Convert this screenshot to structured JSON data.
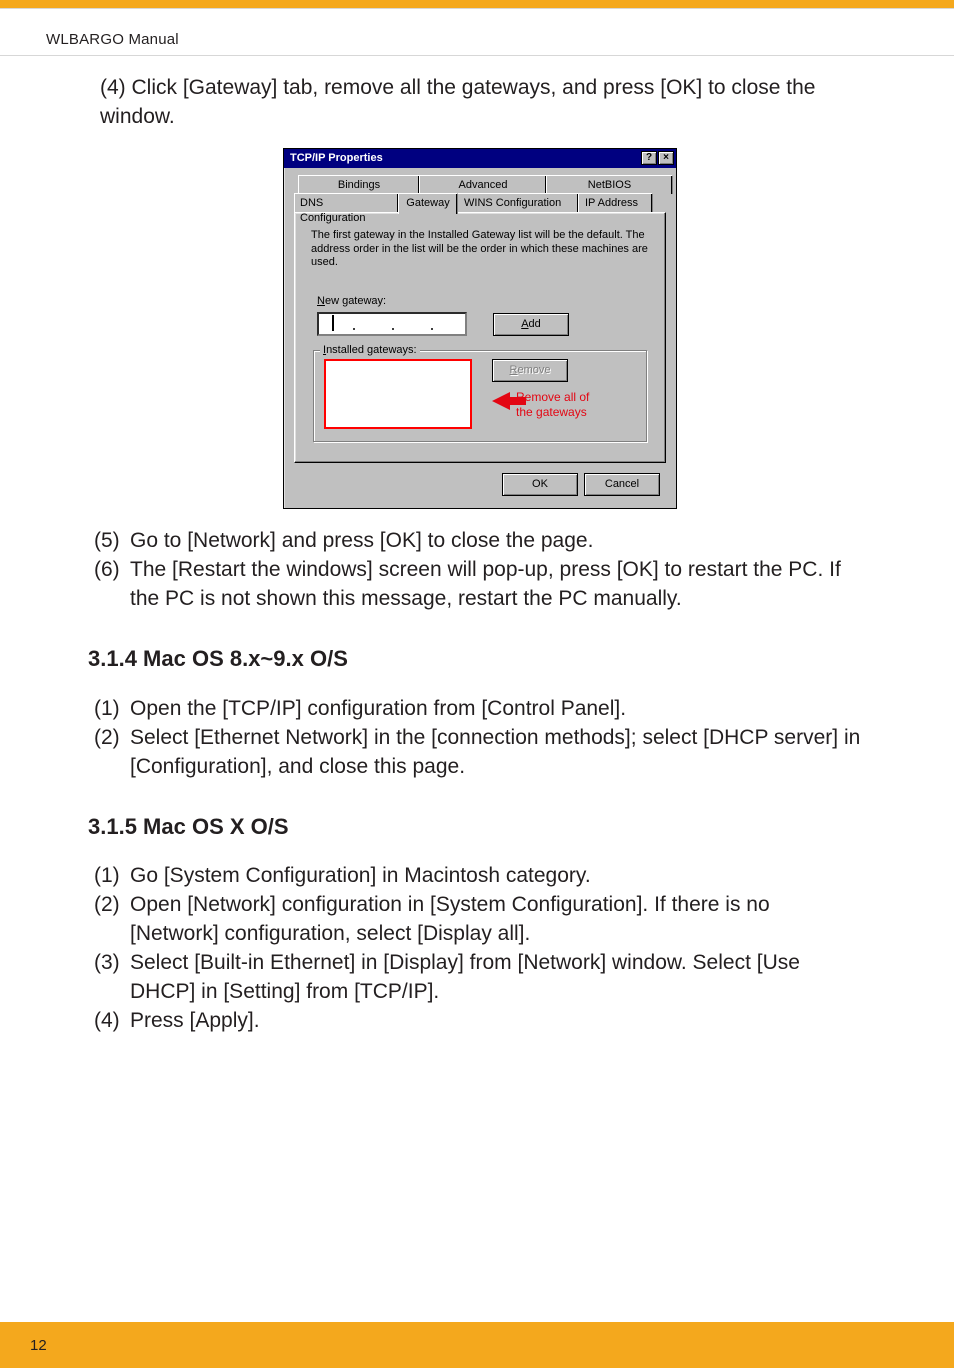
{
  "manual_name": "WLBARGO Manual",
  "page_number": "12",
  "step4": "(4) Click [Gateway] tab, remove all the gateways, and press [OK] to close the window.",
  "dialog": {
    "title": "TCP/IP Properties",
    "help_btn": "?",
    "close_btn": "×",
    "tabs_back": {
      "bindings": "Bindings",
      "advanced": "Advanced",
      "netbios": "NetBIOS"
    },
    "tabs_front": {
      "dns": "DNS Configuration",
      "gateway": "Gateway",
      "wins": "WINS Configuration",
      "ip": "IP Address"
    },
    "description": "The first gateway in the Installed Gateway list will be the default. The address order in the list will be the order in which these machines are used.",
    "new_gateway_lbl": "New gateway:",
    "add_btn": "Add",
    "installed_gateways_lbl": "Installed gateways:",
    "remove_btn": "Remove",
    "annotation_line1": "Remove all of",
    "annotation_line2": "the gateways",
    "ok_btn": "OK",
    "cancel_btn": "Cancel"
  },
  "step5": "Go to [Network] and press [OK] to close the page.",
  "step6": "The [Restart the windows] screen will pop-up, press [OK] to restart the PC. If the PC is not shown this message, restart the PC manually.",
  "macos9_heading": "3.1.4 Mac OS 8.x~9.x O/S",
  "mac9_1": "Open the [TCP/IP] configuration from [Control Panel].",
  "mac9_2": "Select [Ethernet Network] in the [connection methods]; select [DHCP server] in [Configuration], and close this page.",
  "macosx_heading": "3.1.5 Mac OS X O/S",
  "macx_1": "Go [System Configuration] in Macintosh category.",
  "macx_2": "Open [Network] configuration in [System Configuration]. If there is no [Network] configuration, select [Display all].",
  "macx_3": "Select [Built-in Ethernet] in [Display] from [Network] window. Select [Use DHCP] in [Setting] from [TCP/IP].",
  "macx_4": "Press [Apply]."
}
